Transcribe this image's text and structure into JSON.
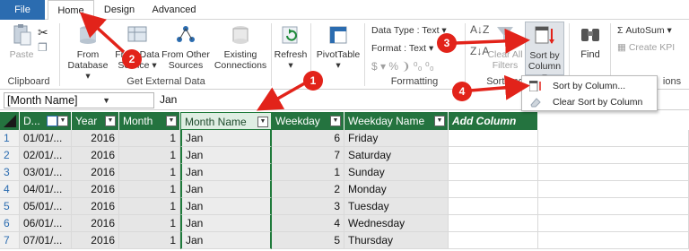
{
  "tabs": {
    "file": "File",
    "home": "Home",
    "design": "Design",
    "advanced": "Advanced"
  },
  "ribbon": {
    "clipboard": {
      "paste": "Paste",
      "group": "Clipboard"
    },
    "external": {
      "from_database": [
        "From",
        "Database ▾"
      ],
      "from_data_service": [
        "From Data",
        "Service ▾"
      ],
      "from_other_sources": [
        "From Other",
        "Sources"
      ],
      "existing_connections": [
        "Existing",
        "Connections"
      ],
      "group": "Get External Data"
    },
    "refresh": [
      "Refresh",
      "▾"
    ],
    "pivottable": [
      "PivotTable",
      "▾"
    ],
    "formatting": {
      "data_type": "Data Type : Text ▾",
      "format": "Format : Text ▾",
      "symbols": "$ ▾ % ❩ ⁰₀ ⁰₀",
      "group": "Formatting"
    },
    "sort": {
      "clear_all_filters": [
        "Clear All",
        "Filters"
      ],
      "sort_by_column": [
        "Sort by",
        "Column ▾"
      ],
      "group": "Sort and"
    },
    "find": "Find",
    "calc": {
      "autosum": "AutoSum ▾",
      "create_kpi": "Create KPI",
      "group_tail": "ions"
    }
  },
  "formula_bar": {
    "name_box": "[Month Name]",
    "value": "Jan"
  },
  "columns": [
    {
      "label": "D...",
      "kind": "date"
    },
    {
      "label": "Year"
    },
    {
      "label": "Month"
    },
    {
      "label": "Month Name"
    },
    {
      "label": "Weekday"
    },
    {
      "label": "Weekday Name"
    },
    {
      "label": "Add Column"
    }
  ],
  "rows": [
    {
      "n": "1",
      "date": "01/01/...",
      "year": "2016",
      "month": "1",
      "month_name": "Jan",
      "weekday": "6",
      "weekday_name": "Friday"
    },
    {
      "n": "2",
      "date": "02/01/...",
      "year": "2016",
      "month": "1",
      "month_name": "Jan",
      "weekday": "7",
      "weekday_name": "Saturday"
    },
    {
      "n": "3",
      "date": "03/01/...",
      "year": "2016",
      "month": "1",
      "month_name": "Jan",
      "weekday": "1",
      "weekday_name": "Sunday"
    },
    {
      "n": "4",
      "date": "04/01/...",
      "year": "2016",
      "month": "1",
      "month_name": "Jan",
      "weekday": "2",
      "weekday_name": "Monday"
    },
    {
      "n": "5",
      "date": "05/01/...",
      "year": "2016",
      "month": "1",
      "month_name": "Jan",
      "weekday": "3",
      "weekday_name": "Tuesday"
    },
    {
      "n": "6",
      "date": "06/01/...",
      "year": "2016",
      "month": "1",
      "month_name": "Jan",
      "weekday": "4",
      "weekday_name": "Wednesday"
    },
    {
      "n": "7",
      "date": "07/01/...",
      "year": "2016",
      "month": "1",
      "month_name": "Jan",
      "weekday": "5",
      "weekday_name": "Thursday"
    }
  ],
  "dropdown_menu": {
    "sort_by_column": "Sort by Column...",
    "clear_sort_by_column": "Clear Sort by Column"
  },
  "callouts": [
    "1",
    "2",
    "3",
    "4"
  ],
  "colors": {
    "header_green": "#24733f",
    "file_blue": "#2b6cb0",
    "callout_red": "#e2231a"
  }
}
